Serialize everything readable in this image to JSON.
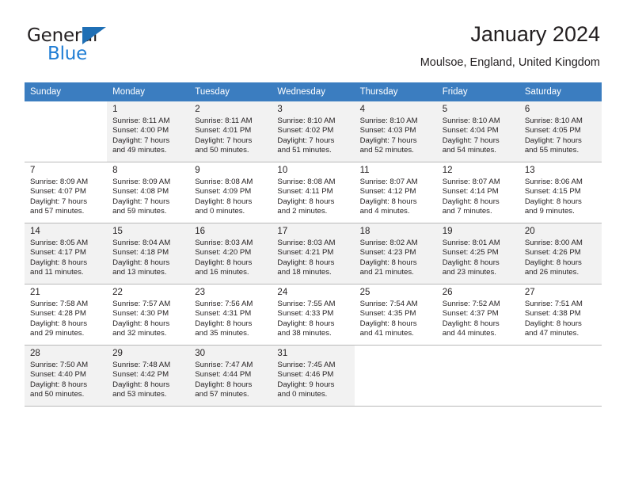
{
  "brand": {
    "name_part1": "General",
    "name_part2": "Blue",
    "triangle_icon": "triangle-icon",
    "accent_color": "#1f7dd4"
  },
  "header": {
    "title": "January 2024",
    "subtitle": "Moulsoe, England, United Kingdom"
  },
  "calendar": {
    "header_bg_color": "#3b7dc0",
    "shaded_row_color": "#f2f2f2",
    "weekday_headers": [
      "Sunday",
      "Monday",
      "Tuesday",
      "Wednesday",
      "Thursday",
      "Friday",
      "Saturday"
    ],
    "weeks": [
      {
        "shaded": true,
        "days": [
          {
            "empty": true
          },
          {
            "day": "1",
            "sunrise": "Sunrise: 8:11 AM",
            "sunset": "Sunset: 4:00 PM",
            "daylight_line1": "Daylight: 7 hours",
            "daylight_line2": "and 49 minutes."
          },
          {
            "day": "2",
            "sunrise": "Sunrise: 8:11 AM",
            "sunset": "Sunset: 4:01 PM",
            "daylight_line1": "Daylight: 7 hours",
            "daylight_line2": "and 50 minutes."
          },
          {
            "day": "3",
            "sunrise": "Sunrise: 8:10 AM",
            "sunset": "Sunset: 4:02 PM",
            "daylight_line1": "Daylight: 7 hours",
            "daylight_line2": "and 51 minutes."
          },
          {
            "day": "4",
            "sunrise": "Sunrise: 8:10 AM",
            "sunset": "Sunset: 4:03 PM",
            "daylight_line1": "Daylight: 7 hours",
            "daylight_line2": "and 52 minutes."
          },
          {
            "day": "5",
            "sunrise": "Sunrise: 8:10 AM",
            "sunset": "Sunset: 4:04 PM",
            "daylight_line1": "Daylight: 7 hours",
            "daylight_line2": "and 54 minutes."
          },
          {
            "day": "6",
            "sunrise": "Sunrise: 8:10 AM",
            "sunset": "Sunset: 4:05 PM",
            "daylight_line1": "Daylight: 7 hours",
            "daylight_line2": "and 55 minutes."
          }
        ]
      },
      {
        "shaded": false,
        "days": [
          {
            "day": "7",
            "sunrise": "Sunrise: 8:09 AM",
            "sunset": "Sunset: 4:07 PM",
            "daylight_line1": "Daylight: 7 hours",
            "daylight_line2": "and 57 minutes."
          },
          {
            "day": "8",
            "sunrise": "Sunrise: 8:09 AM",
            "sunset": "Sunset: 4:08 PM",
            "daylight_line1": "Daylight: 7 hours",
            "daylight_line2": "and 59 minutes."
          },
          {
            "day": "9",
            "sunrise": "Sunrise: 8:08 AM",
            "sunset": "Sunset: 4:09 PM",
            "daylight_line1": "Daylight: 8 hours",
            "daylight_line2": "and 0 minutes."
          },
          {
            "day": "10",
            "sunrise": "Sunrise: 8:08 AM",
            "sunset": "Sunset: 4:11 PM",
            "daylight_line1": "Daylight: 8 hours",
            "daylight_line2": "and 2 minutes."
          },
          {
            "day": "11",
            "sunrise": "Sunrise: 8:07 AM",
            "sunset": "Sunset: 4:12 PM",
            "daylight_line1": "Daylight: 8 hours",
            "daylight_line2": "and 4 minutes."
          },
          {
            "day": "12",
            "sunrise": "Sunrise: 8:07 AM",
            "sunset": "Sunset: 4:14 PM",
            "daylight_line1": "Daylight: 8 hours",
            "daylight_line2": "and 7 minutes."
          },
          {
            "day": "13",
            "sunrise": "Sunrise: 8:06 AM",
            "sunset": "Sunset: 4:15 PM",
            "daylight_line1": "Daylight: 8 hours",
            "daylight_line2": "and 9 minutes."
          }
        ]
      },
      {
        "shaded": true,
        "days": [
          {
            "day": "14",
            "sunrise": "Sunrise: 8:05 AM",
            "sunset": "Sunset: 4:17 PM",
            "daylight_line1": "Daylight: 8 hours",
            "daylight_line2": "and 11 minutes."
          },
          {
            "day": "15",
            "sunrise": "Sunrise: 8:04 AM",
            "sunset": "Sunset: 4:18 PM",
            "daylight_line1": "Daylight: 8 hours",
            "daylight_line2": "and 13 minutes."
          },
          {
            "day": "16",
            "sunrise": "Sunrise: 8:03 AM",
            "sunset": "Sunset: 4:20 PM",
            "daylight_line1": "Daylight: 8 hours",
            "daylight_line2": "and 16 minutes."
          },
          {
            "day": "17",
            "sunrise": "Sunrise: 8:03 AM",
            "sunset": "Sunset: 4:21 PM",
            "daylight_line1": "Daylight: 8 hours",
            "daylight_line2": "and 18 minutes."
          },
          {
            "day": "18",
            "sunrise": "Sunrise: 8:02 AM",
            "sunset": "Sunset: 4:23 PM",
            "daylight_line1": "Daylight: 8 hours",
            "daylight_line2": "and 21 minutes."
          },
          {
            "day": "19",
            "sunrise": "Sunrise: 8:01 AM",
            "sunset": "Sunset: 4:25 PM",
            "daylight_line1": "Daylight: 8 hours",
            "daylight_line2": "and 23 minutes."
          },
          {
            "day": "20",
            "sunrise": "Sunrise: 8:00 AM",
            "sunset": "Sunset: 4:26 PM",
            "daylight_line1": "Daylight: 8 hours",
            "daylight_line2": "and 26 minutes."
          }
        ]
      },
      {
        "shaded": false,
        "days": [
          {
            "day": "21",
            "sunrise": "Sunrise: 7:58 AM",
            "sunset": "Sunset: 4:28 PM",
            "daylight_line1": "Daylight: 8 hours",
            "daylight_line2": "and 29 minutes."
          },
          {
            "day": "22",
            "sunrise": "Sunrise: 7:57 AM",
            "sunset": "Sunset: 4:30 PM",
            "daylight_line1": "Daylight: 8 hours",
            "daylight_line2": "and 32 minutes."
          },
          {
            "day": "23",
            "sunrise": "Sunrise: 7:56 AM",
            "sunset": "Sunset: 4:31 PM",
            "daylight_line1": "Daylight: 8 hours",
            "daylight_line2": "and 35 minutes."
          },
          {
            "day": "24",
            "sunrise": "Sunrise: 7:55 AM",
            "sunset": "Sunset: 4:33 PM",
            "daylight_line1": "Daylight: 8 hours",
            "daylight_line2": "and 38 minutes."
          },
          {
            "day": "25",
            "sunrise": "Sunrise: 7:54 AM",
            "sunset": "Sunset: 4:35 PM",
            "daylight_line1": "Daylight: 8 hours",
            "daylight_line2": "and 41 minutes."
          },
          {
            "day": "26",
            "sunrise": "Sunrise: 7:52 AM",
            "sunset": "Sunset: 4:37 PM",
            "daylight_line1": "Daylight: 8 hours",
            "daylight_line2": "and 44 minutes."
          },
          {
            "day": "27",
            "sunrise": "Sunrise: 7:51 AM",
            "sunset": "Sunset: 4:38 PM",
            "daylight_line1": "Daylight: 8 hours",
            "daylight_line2": "and 47 minutes."
          }
        ]
      },
      {
        "shaded": true,
        "days": [
          {
            "day": "28",
            "sunrise": "Sunrise: 7:50 AM",
            "sunset": "Sunset: 4:40 PM",
            "daylight_line1": "Daylight: 8 hours",
            "daylight_line2": "and 50 minutes."
          },
          {
            "day": "29",
            "sunrise": "Sunrise: 7:48 AM",
            "sunset": "Sunset: 4:42 PM",
            "daylight_line1": "Daylight: 8 hours",
            "daylight_line2": "and 53 minutes."
          },
          {
            "day": "30",
            "sunrise": "Sunrise: 7:47 AM",
            "sunset": "Sunset: 4:44 PM",
            "daylight_line1": "Daylight: 8 hours",
            "daylight_line2": "and 57 minutes."
          },
          {
            "day": "31",
            "sunrise": "Sunrise: 7:45 AM",
            "sunset": "Sunset: 4:46 PM",
            "daylight_line1": "Daylight: 9 hours",
            "daylight_line2": "and 0 minutes."
          },
          {
            "empty": true
          },
          {
            "empty": true
          },
          {
            "empty": true
          }
        ]
      }
    ]
  }
}
